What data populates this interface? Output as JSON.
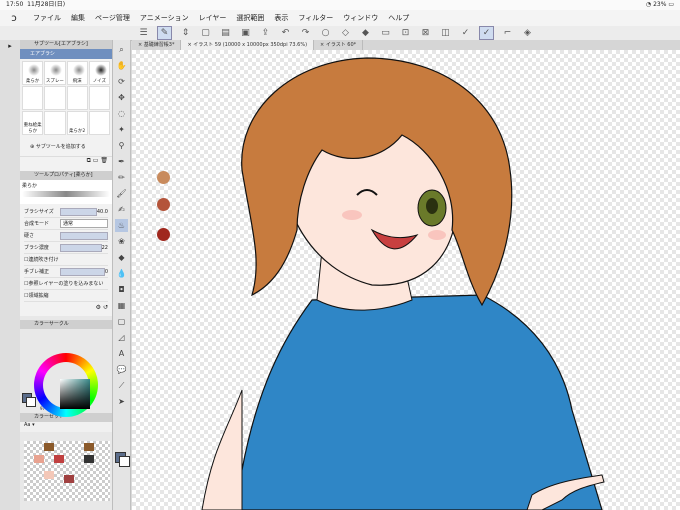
{
  "status": {
    "time": "17:50",
    "date": "11月28日(日)",
    "battery": "23%"
  },
  "menu": [
    "ファイル",
    "編集",
    "ページ管理",
    "アニメーション",
    "レイヤー",
    "選択範囲",
    "表示",
    "フィルター",
    "ウィンドウ",
    "ヘルプ"
  ],
  "tabs": [
    "基礎練習帳3*",
    "イラスト 59 (10000 x 10000px 350dpi 73.6%)",
    "イラスト 60*"
  ],
  "subtool": {
    "header": "サブツール[エアブラシ]",
    "selected": "エアブラシ",
    "brushes": [
      "柔らか",
      "スプレー",
      "飛沫",
      "ノイズ",
      "",
      "",
      "",
      "",
      "重ね絵柔らか",
      "",
      "柔らか2",
      ""
    ],
    "add_label": "サブツールを追加する"
  },
  "toolprop": {
    "header": "ツールプロパティ[柔らか]",
    "preview_label": "柔らか",
    "rows": [
      {
        "k": "ブラシサイズ",
        "v": "40.0"
      },
      {
        "k": "合成モード",
        "v": "通常"
      },
      {
        "k": "硬さ",
        "v": ""
      },
      {
        "k": "ブラシ濃度",
        "v": "22"
      },
      {
        "k": "連続吹き付け",
        "v": ""
      },
      {
        "k": "手ブレ補正",
        "v": "0"
      },
      {
        "k": "参照レイヤーの塗りを込みまない",
        "v": ""
      },
      {
        "k": "領域拡縮",
        "v": ""
      }
    ]
  },
  "colorcircle": {
    "header": "カラーサークル",
    "values": [
      "97",
      "97",
      "97"
    ]
  },
  "colorset": {
    "header": "カラーセット",
    "select": "Aa"
  },
  "canvas_swatches": [
    "#c88a5c",
    "#b4543a",
    "#a0281e"
  ],
  "colors": {
    "hair": "#c77b3e",
    "shirt": "#2f86c6",
    "skin": "#fde6dc",
    "accent": "#6f8fbf"
  }
}
